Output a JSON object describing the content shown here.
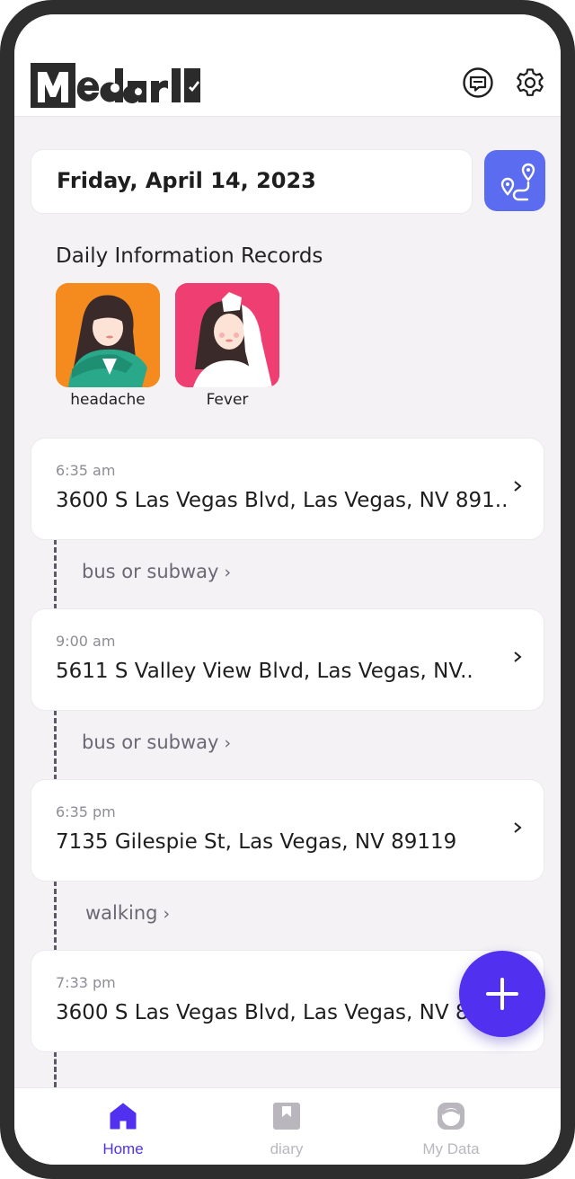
{
  "app": {
    "logo_text": "Medarl"
  },
  "header": {
    "chat_icon": "chat-bubble-icon",
    "settings_icon": "gear-icon"
  },
  "date": {
    "label": "Friday, April 14, 2023",
    "route_icon": "route-map-icon"
  },
  "daily_records": {
    "title": "Daily Information Records",
    "items": [
      {
        "label": "headache",
        "bg": "#f58a1f"
      },
      {
        "label": "Fever",
        "bg": "#ef3f72"
      }
    ]
  },
  "timeline": [
    {
      "time": "6:35 am",
      "address": "3600 S Las Vegas Blvd, Las Vegas, NV 891..",
      "transit_after": "bus or subway"
    },
    {
      "time": "9:00 am",
      "address": "5611 S Valley View Blvd, Las Vegas, NV..",
      "transit_after": "bus or subway"
    },
    {
      "time": "6:35 pm",
      "address": "7135 Gilespie St, Las Vegas, NV 89119",
      "transit_after": "walking"
    },
    {
      "time": "7:33 pm",
      "address": "3600 S Las Vegas Blvd, Las Vegas, NV 891..",
      "transit_after": ""
    }
  ],
  "transit_chevron": "›",
  "fab": {
    "icon": "plus-icon"
  },
  "bottom_nav": {
    "items": [
      {
        "label": "Home",
        "icon": "home-icon",
        "active": true
      },
      {
        "label": "diary",
        "icon": "bookmark-book-icon",
        "active": false
      },
      {
        "label": "My Data",
        "icon": "profile-face-icon",
        "active": false
      }
    ]
  },
  "colors": {
    "accent": "#5130f0",
    "route_button": "#5b6cf0",
    "inactive_nav": "#b9b7bd",
    "background": "#f4f2f4"
  }
}
